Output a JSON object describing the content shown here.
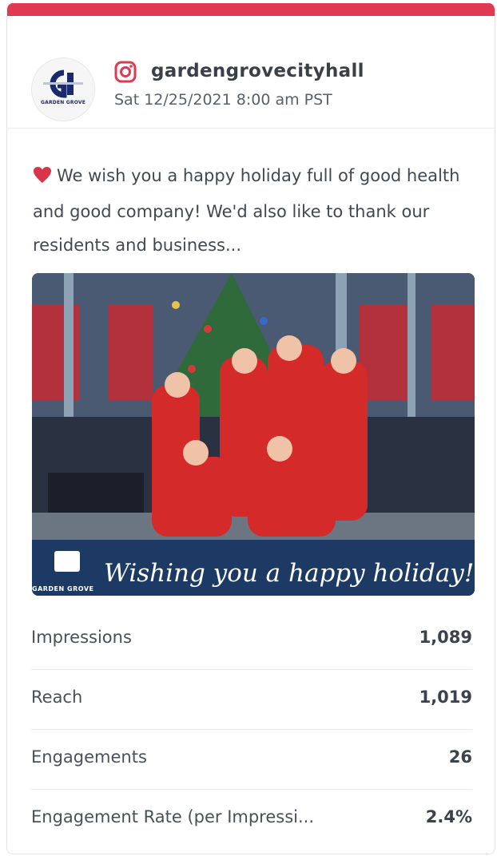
{
  "post": {
    "username": "gardengrovecityhall",
    "timestamp": "Sat 12/25/2021 8:00 am PST",
    "avatar_brand": "GARDEN GROVE",
    "caption": "We wish you a happy holiday full of good health and good company! We'd also like to thank our residents and business...",
    "image_overlay_text": "Wishing you a happy holiday!",
    "image_brand": "GARDEN GROVE",
    "platform_icon": "instagram-icon",
    "accent_color": "#e03a52"
  },
  "stats": [
    {
      "label": "Impressions",
      "value": "1,089"
    },
    {
      "label": "Reach",
      "value": "1,019"
    },
    {
      "label": "Engagements",
      "value": "26"
    },
    {
      "label": "Engagement Rate (per Impressi...",
      "value": "2.4%"
    }
  ]
}
